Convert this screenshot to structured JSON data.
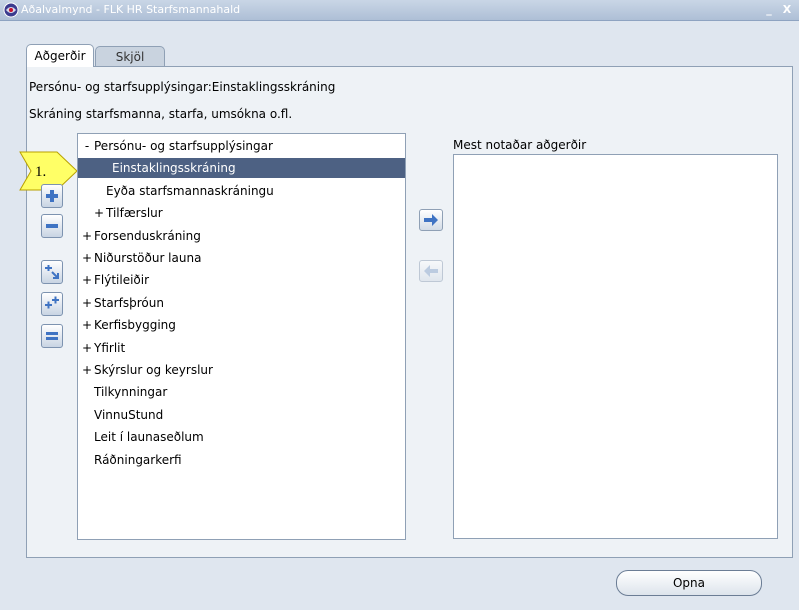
{
  "window": {
    "title": "Aðalvalmynd - FLK HR Starfsmannahald",
    "minimize_label": "_",
    "close_label": "X"
  },
  "tabs": [
    {
      "label": "Aðgerðir",
      "active": true
    },
    {
      "label": "Skjöl",
      "active": false
    }
  ],
  "panel": {
    "line1": "Persónu- og starfsupplýsingar:Einstaklingsskráning",
    "line2": "Skráning starfsmanna, starfa, umsókna o.fl."
  },
  "step_badge": "1.",
  "tree": [
    {
      "prefix": "-",
      "label": "Persónu- og starfsupplýsingar",
      "level": 0,
      "selected": false
    },
    {
      "prefix": "",
      "label": "Einstaklingsskráning",
      "level": 1,
      "selected": true
    },
    {
      "prefix": "",
      "label": "Eyða starfsmannaskráningu",
      "level": 1,
      "selected": false
    },
    {
      "prefix": "+",
      "label": "Tilfærslur",
      "level": 1,
      "selected": false
    },
    {
      "prefix": "+",
      "label": "Forsenduskráning",
      "level": 0,
      "selected": false
    },
    {
      "prefix": "+",
      "label": "Niðurstöður launa",
      "level": 0,
      "selected": false
    },
    {
      "prefix": "+",
      "label": "Flýtileiðir",
      "level": 0,
      "selected": false
    },
    {
      "prefix": "+",
      "label": "Starfsþróun",
      "level": 0,
      "selected": false
    },
    {
      "prefix": "+",
      "label": "Kerfisbygging",
      "level": 0,
      "selected": false
    },
    {
      "prefix": "+",
      "label": "Yfirlit",
      "level": 0,
      "selected": false
    },
    {
      "prefix": "+",
      "label": "Skýrslur og keyrslur",
      "level": 0,
      "selected": false
    },
    {
      "prefix": "",
      "label": "Tilkynningar",
      "level": 0,
      "selected": false
    },
    {
      "prefix": "",
      "label": "VinnuStund",
      "level": 0,
      "selected": false
    },
    {
      "prefix": "",
      "label": "Leit í launaseðlum",
      "level": 0,
      "selected": false
    },
    {
      "prefix": "",
      "label": "Ráðningarkerfi",
      "level": 0,
      "selected": false
    }
  ],
  "favorites": {
    "label": "Mest notaðar aðgerðir",
    "items": []
  },
  "open_button": "Opna",
  "colors": {
    "selection": "#4d6183",
    "accent_blue": "#3f73c3",
    "badge_yellow": "#ffff66"
  },
  "icons": {
    "app": "oracle-globe-icon",
    "expand": "plus-icon",
    "collapse": "minus-icon",
    "focus": "focus-plus-arrow-icon",
    "expand_all": "expand-all-icon",
    "collapse_all": "collapse-all-icon",
    "add_favorite": "arrow-right-icon",
    "remove_favorite": "arrow-left-icon"
  }
}
